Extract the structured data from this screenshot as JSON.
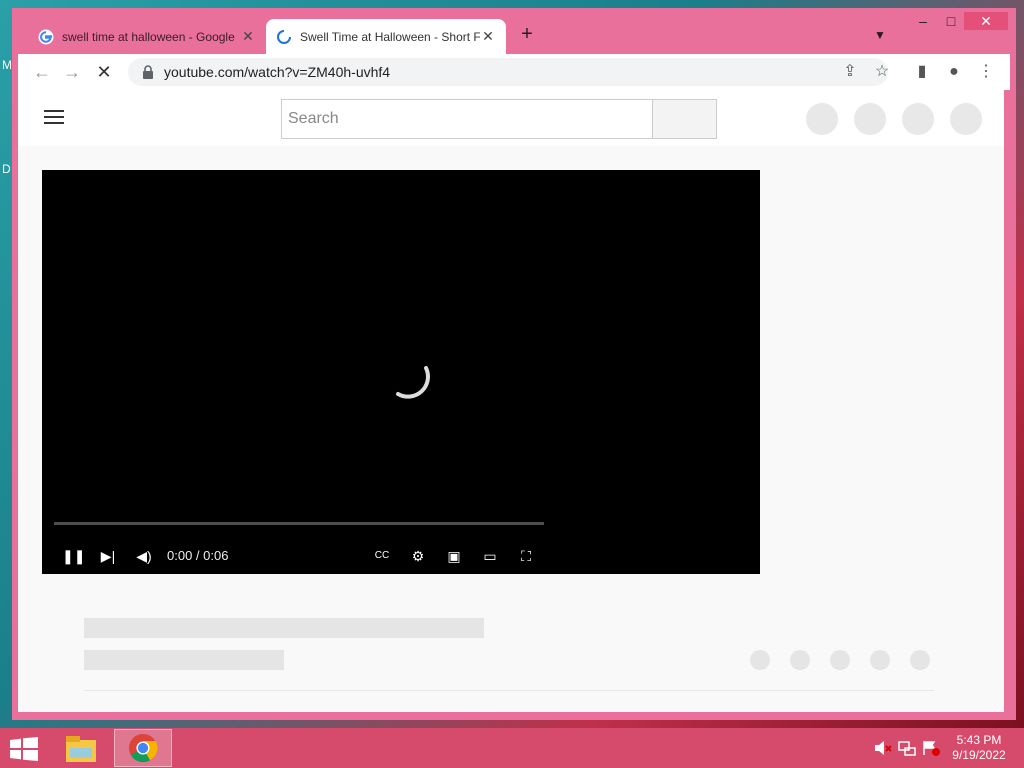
{
  "browser": {
    "tabs": [
      {
        "title": "swell time at halloween - Google",
        "active": false
      },
      {
        "title": "Swell Time at Halloween - Short F",
        "active": true
      }
    ],
    "url": "youtube.com/watch?v=ZM40h-uvhf4"
  },
  "youtube": {
    "search_placeholder": "Search"
  },
  "player": {
    "time": "0:00 / 0:06",
    "progress": 0
  },
  "desktop": {
    "letters": [
      "M",
      "D"
    ]
  },
  "taskbar": {
    "time": "5:43 PM",
    "date": "9/19/2022"
  }
}
